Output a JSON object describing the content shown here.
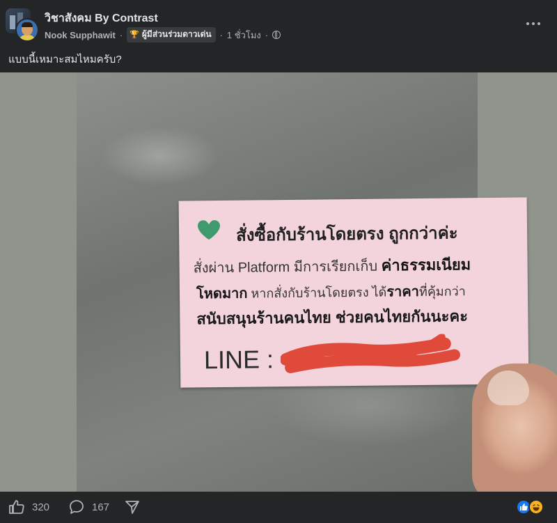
{
  "post": {
    "group_name": "วิชาสังคม By Contrast",
    "author": "Nook Supphawit",
    "separator": "·",
    "badge_label": "ผู้มีส่วนร่วมดาวเด่น",
    "time": "1 ชั่วโมง",
    "caption": "แบบนี้เหมาะสมไหมครับ?"
  },
  "note": {
    "line1": "สั่งซื้อกับร้านโดยตรง ถูกกว่าค่ะ",
    "line2_a": "สั่งผ่าน Platform มีการเรียกเก็บ ",
    "line2_b": "ค่าธรรมเนียม",
    "line3_a": "โหดมาก",
    "line3_b": " หากสั่งกับร้านโดยตรง ได้",
    "line3_c": "ราคา",
    "line3_d": "ที่คุ้มกว่า",
    "line4": "สนับสนุนร้านคนไทย ช่วยคนไทยกันนะคะ",
    "line5": "LINE :"
  },
  "footer": {
    "like_count": "320",
    "comment_count": "167"
  },
  "icons": {
    "more": "more-options-icon",
    "privacy": "globe-icon",
    "badge": "trophy-icon",
    "like": "thumbs-up-icon",
    "comment": "comment-bubble-icon",
    "share": "share-arrow-icon"
  },
  "colors": {
    "background": "#242526",
    "text_primary": "#e4e6eb",
    "text_secondary": "#b0b3b8",
    "note_paper": "#f3d4dc",
    "heart": "#3f9a6e",
    "redaction": "#e04a3a",
    "like_reaction": "#1877f2",
    "haha_reaction": "#f7b125"
  }
}
